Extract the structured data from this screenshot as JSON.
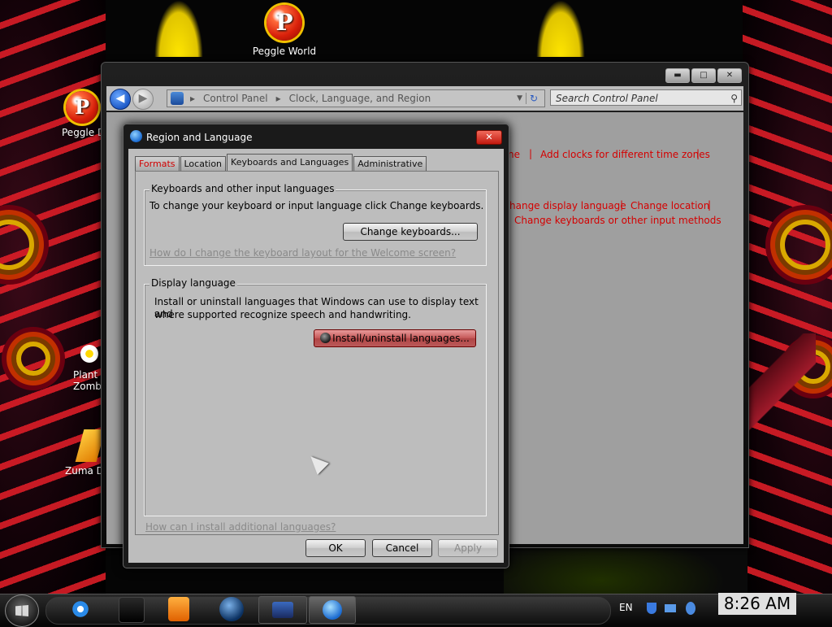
{
  "desktop": {
    "icons": [
      {
        "name": "peggle-world",
        "label": "Peggle World"
      },
      {
        "name": "peggle-deluxe",
        "label": "Peggle D"
      },
      {
        "name": "plants-zombies",
        "label": "Plant\nZomb"
      },
      {
        "name": "zuma-deluxe",
        "label": "Zuma D"
      }
    ]
  },
  "control_panel": {
    "address": {
      "seg1": "Control Panel",
      "seg2": "Clock, Language, and Region"
    },
    "search_placeholder": "Search Control Panel",
    "links": {
      "time_zone_tail": "ne",
      "add_clocks": "Add clocks for different time zones",
      "change_display_language": "hange display language",
      "change_location": "Change location",
      "change_keyboards": "Change keyboards or other input methods"
    },
    "title_buttons": {
      "minimize": "▬",
      "maximize": "□",
      "close": "✕"
    }
  },
  "dialog": {
    "title": "Region and Language",
    "close_label": "✕",
    "tabs": [
      {
        "label": "Formats"
      },
      {
        "label": "Location"
      },
      {
        "label": "Keyboards and Languages"
      },
      {
        "label": "Administrative"
      }
    ],
    "keyboards_group": {
      "label": "Keyboards and other input languages",
      "description": "To change your keyboard or input language click Change keyboards.",
      "button": "Change keyboards...",
      "help_link": "How do I change the keyboard layout for the Welcome screen?"
    },
    "display_group": {
      "label": "Display language",
      "description_line1": "Install or uninstall languages that Windows can use to display text and",
      "description_line2": "where supported recognize speech and handwriting.",
      "button": "Install/uninstall languages..."
    },
    "additional_link": "How can I install additional languages?",
    "buttons": {
      "ok": "OK",
      "cancel": "Cancel",
      "apply": "Apply"
    }
  },
  "taskbar": {
    "language": "EN",
    "time": "8:26 AM"
  },
  "colors": {
    "link_red": "#d40000",
    "accent_blue": "#1e5ac8"
  }
}
